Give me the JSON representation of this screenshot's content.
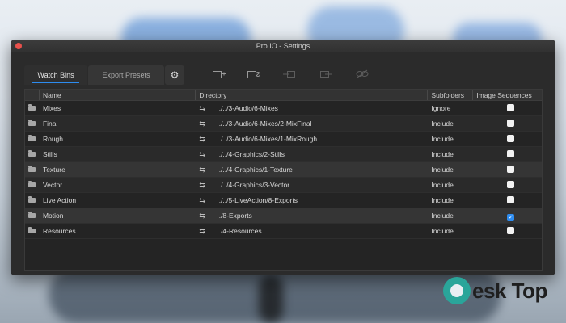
{
  "window": {
    "title": "Pro IO - Settings"
  },
  "tabs": [
    {
      "label": "Watch Bins",
      "active": true
    },
    {
      "label": "Export Presets",
      "active": false
    }
  ],
  "toolbar": {
    "settings_icon": "gear-icon",
    "tools": [
      "add-folder-icon",
      "remove-folder-icon",
      "import-icon",
      "export-icon",
      "unlink-icon"
    ]
  },
  "table": {
    "headers": [
      "Name",
      "Directory",
      "Subfolders",
      "Image Sequences"
    ],
    "rows": [
      {
        "name": "Mixes",
        "directory": "../../3-Audio/6-Mixes",
        "subfolders": "Ignore",
        "image_sequences": false
      },
      {
        "name": "Final",
        "directory": "../../3-Audio/6-Mixes/2-MixFinal",
        "subfolders": "Include",
        "image_sequences": false
      },
      {
        "name": "Rough",
        "directory": "../../3-Audio/6-Mixes/1-MixRough",
        "subfolders": "Include",
        "image_sequences": false
      },
      {
        "name": "Stills",
        "directory": "../../4-Graphics/2-Stills",
        "subfolders": "Include",
        "image_sequences": false
      },
      {
        "name": "Texture",
        "directory": "../../4-Graphics/1-Texture",
        "subfolders": "Include",
        "image_sequences": false
      },
      {
        "name": "Vector",
        "directory": "../../4-Graphics/3-Vector",
        "subfolders": "Include",
        "image_sequences": false
      },
      {
        "name": "Live Action",
        "directory": "../../5-LiveAction/8-Exports",
        "subfolders": "Include",
        "image_sequences": false
      },
      {
        "name": "Motion",
        "directory": "../8-Exports",
        "subfolders": "Include",
        "image_sequences": true
      },
      {
        "name": "Resources",
        "directory": "../4-Resources",
        "subfolders": "Include",
        "image_sequences": false
      }
    ]
  },
  "watermark": {
    "text": "esk Top"
  },
  "colors": {
    "accent": "#2d8cf0",
    "window_bg": "#2b2b2b",
    "close": "#e9514c"
  }
}
